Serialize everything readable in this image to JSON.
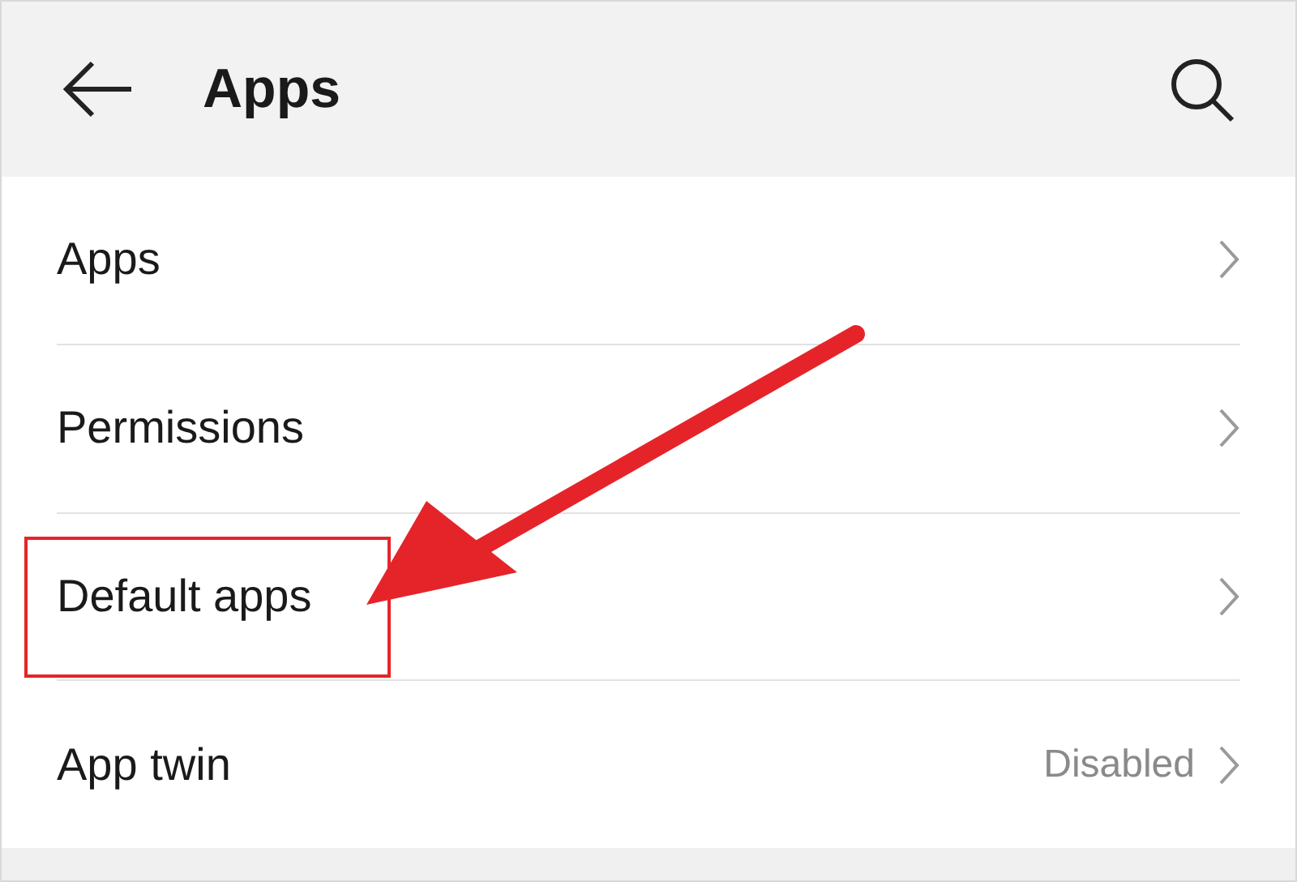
{
  "header": {
    "title": "Apps"
  },
  "rows": [
    {
      "label": "Apps",
      "highlighted": false
    },
    {
      "label": "Permissions",
      "highlighted": false
    },
    {
      "label": "Default apps",
      "highlighted": true
    },
    {
      "label": "App twin",
      "value": "Disabled",
      "highlighted": false
    }
  ]
}
